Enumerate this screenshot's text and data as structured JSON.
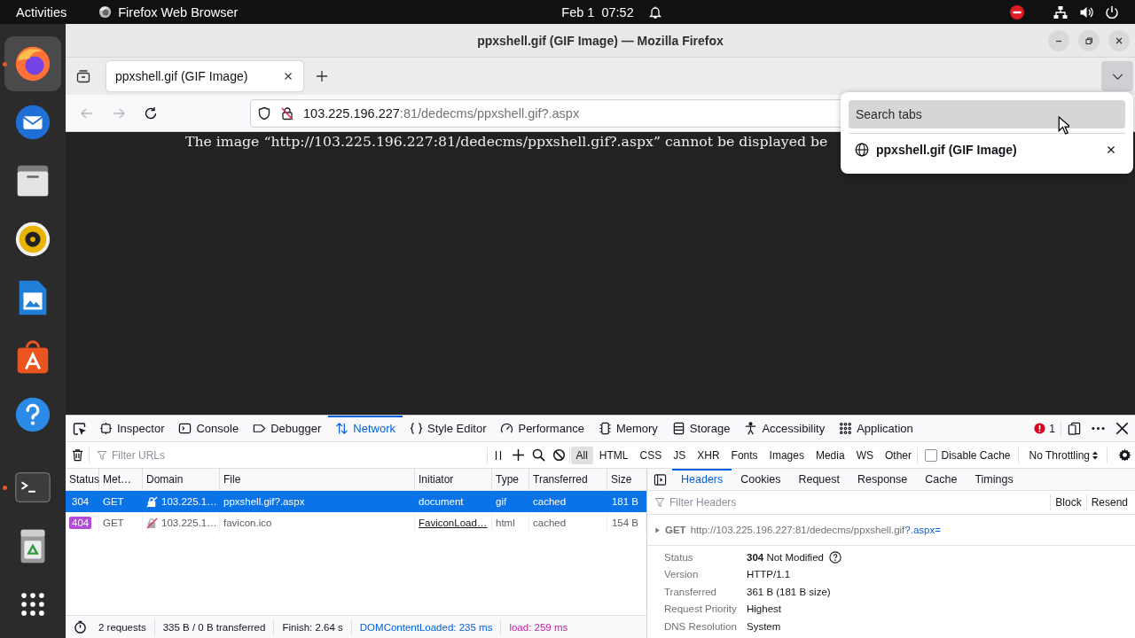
{
  "top_bar": {
    "activities": "Activities",
    "app_menu": "Firefox Web Browser",
    "clock": "Feb 1  07:52"
  },
  "dock": [
    {
      "running": true,
      "selected": true
    },
    {
      "running": false,
      "selected": false
    },
    {
      "running": false,
      "selected": false
    },
    {
      "running": false,
      "selected": false
    },
    {
      "running": false,
      "selected": false
    },
    {
      "running": false,
      "selected": false
    },
    {
      "running": false,
      "selected": false
    },
    {
      "running": true,
      "selected": false
    },
    {
      "running": false,
      "selected": false
    },
    {
      "running": false,
      "selected": false
    }
  ],
  "window": {
    "title": "ppxshell.gif (GIF Image) — Mozilla Firefox"
  },
  "tabs": [
    {
      "title": "ppxshell.gif (GIF Image)",
      "selected": true
    }
  ],
  "tab_list_button": {
    "expanded": true
  },
  "nav_buttons": [
    {
      "kind": "back",
      "disabled": true
    },
    {
      "kind": "forward",
      "disabled": true
    },
    {
      "kind": "reload",
      "disabled": false
    }
  ],
  "url_bar": {
    "host": "103.225.196.227",
    "rest": ":81/dedecms/ppxshell.gif?.aspx"
  },
  "page": {
    "message": "The image “http://103.225.196.227:81/dedecms/ppxshell.gif?.aspx” cannot be displayed be"
  },
  "tab_search_popup": {
    "placeholder": "Search tabs",
    "items": [
      {
        "title": "ppxshell.gif (GIF Image)"
      }
    ]
  },
  "devtools": {
    "tools": [
      {
        "label": "Inspector",
        "selected": false
      },
      {
        "label": "Console",
        "selected": false
      },
      {
        "label": "Debugger",
        "selected": false
      },
      {
        "label": "Network",
        "selected": true
      },
      {
        "label": "Style Editor",
        "selected": false
      },
      {
        "label": "Performance",
        "selected": false
      },
      {
        "label": "Memory",
        "selected": false
      },
      {
        "label": "Storage",
        "selected": false
      },
      {
        "label": "Accessibility",
        "selected": false
      },
      {
        "label": "Application",
        "selected": false
      }
    ],
    "error_count": "1",
    "filter": {
      "placeholder": "Filter URLs"
    },
    "type_filters": [
      {
        "label": "All",
        "selected": true
      },
      {
        "label": "HTML",
        "selected": false
      },
      {
        "label": "CSS",
        "selected": false
      },
      {
        "label": "JS",
        "selected": false
      },
      {
        "label": "XHR",
        "selected": false
      },
      {
        "label": "Fonts",
        "selected": false
      },
      {
        "label": "Images",
        "selected": false
      },
      {
        "label": "Media",
        "selected": false
      },
      {
        "label": "WS",
        "selected": false
      },
      {
        "label": "Other",
        "selected": false
      }
    ],
    "disable_cache": {
      "label": "Disable Cache",
      "checked": false
    },
    "throttling": "No Throttling",
    "table": {
      "columns": [
        "Status",
        "Met…",
        "Domain",
        "File",
        "Initiator",
        "Type",
        "Transferred",
        "Size"
      ],
      "rows": [
        {
          "selected": true,
          "status": "304",
          "status_badge": false,
          "method": "GET",
          "domain": "103.225.1…",
          "file": "ppxshell.gif?.aspx",
          "initiator": "document",
          "initiator_link": false,
          "type": "gif",
          "transferred": "cached",
          "size": "181 B"
        },
        {
          "selected": false,
          "status": "404",
          "status_badge": true,
          "method": "GET",
          "domain": "103.225.1…",
          "file": "favicon.ico",
          "initiator": "FaviconLoad…",
          "initiator_link": true,
          "type": "html",
          "transferred": "cached",
          "size": "154 B"
        }
      ]
    },
    "summary": {
      "requests": "2 requests",
      "transferred": "335 B / 0 B transferred",
      "finish": "Finish: 2.64 s",
      "dom_content_loaded": "DOMContentLoaded: 235 ms",
      "load": "load: 259 ms"
    },
    "details": {
      "tabs": [
        {
          "label": "Headers",
          "selected": true
        },
        {
          "label": "Cookies",
          "selected": false
        },
        {
          "label": "Request",
          "selected": false
        },
        {
          "label": "Response",
          "selected": false
        },
        {
          "label": "Cache",
          "selected": false
        },
        {
          "label": "Timings",
          "selected": false
        }
      ],
      "filter": {
        "placeholder": "Filter Headers"
      },
      "actions": [
        "Block",
        "Resend"
      ],
      "request": {
        "method": "GET",
        "url": "http://103.225.196.227:81/dedecms/ppxshell.gif",
        "query": "?.aspx=",
        "expanded": false
      },
      "fields": [
        {
          "label": "Status",
          "value": "**304** Not Modified",
          "help": true
        },
        {
          "label": "Version",
          "value": "HTTP/1.1",
          "help": false
        },
        {
          "label": "Transferred",
          "value": "361 B (181 B size)",
          "help": false
        },
        {
          "label": "Request Priority",
          "value": "Highest",
          "help": false
        },
        {
          "label": "DNS Resolution",
          "value": "System",
          "help": false
        }
      ]
    }
  }
}
